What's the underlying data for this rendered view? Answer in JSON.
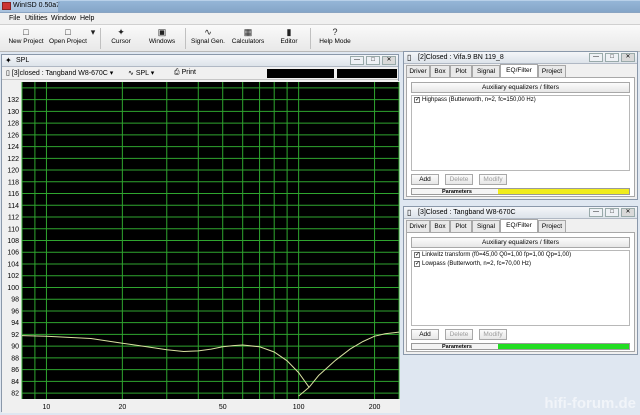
{
  "app": {
    "title": "WinISD 0.50a7"
  },
  "menu": [
    "File",
    "Utilities",
    "Window",
    "Help"
  ],
  "toolbar": {
    "new_project": "New Project",
    "open_project": "Open Project",
    "cursor": "Cursor",
    "windows": "Windows",
    "signal_gen": "Signal Gen.",
    "calculators": "Calculators",
    "editor": "Editor",
    "help_mode": "Help Mode",
    "help_icon": "?"
  },
  "spl_window": {
    "title": "SPL",
    "project_select": "[3]closed : Tangband W8-670C",
    "graph_select": "SPL",
    "print": "Print"
  },
  "panel_top": {
    "title": "[2]Closed : Vifa.9 BN 119_8",
    "tabs": [
      "Driver",
      "Box",
      "Plot",
      "Signal",
      "EQ/Filter",
      "Project"
    ],
    "active_tab": "EQ/Filter",
    "aux_button": "Auxiliary equalizers / filters",
    "filters": [
      "Highpass (Butterworth, n=2, fc=150,00 Hz)"
    ],
    "add": "Add",
    "delete": "Delete",
    "modify": "Modify",
    "parameters": "Parameters",
    "status_color": "#f0ec1c"
  },
  "panel_bottom": {
    "title": "[3]Closed : Tangband W8-670C",
    "tabs": [
      "Driver",
      "Box",
      "Plot",
      "Signal",
      "EQ/Filter",
      "Project"
    ],
    "active_tab": "EQ/Filter",
    "aux_button": "Auxiliary equalizers / filters",
    "filters": [
      "Linkwitz transform (f0=45,00 Q0=1,00 fp=1,00 Qp=1,00)",
      "Lowpass (Butterworth, n=2, fc=70,00 Hz)"
    ],
    "add": "Add",
    "delete": "Delete",
    "modify": "Modify",
    "parameters": "Parameters",
    "status_color": "#22dd22"
  },
  "watermark": "hifi-forum.de",
  "chart_data": {
    "type": "line",
    "x_scale": "log",
    "xlim": [
      8,
      250
    ],
    "ylim": [
      81,
      135
    ],
    "grid": true,
    "background": "#000000",
    "grid_color": "#2fa52f",
    "line_color": "#d8e0a0",
    "x_tick_labels": [
      10,
      20,
      50,
      100,
      200
    ],
    "y_tick_labels": [
      82,
      84,
      86,
      88,
      90,
      92,
      94,
      96,
      98,
      100,
      102,
      104,
      106,
      108,
      110,
      112,
      114,
      116,
      118,
      120,
      122,
      124,
      126,
      128,
      130,
      132
    ],
    "series": [
      {
        "x": [
          8,
          10,
          15,
          20,
          25,
          30,
          35,
          40,
          45,
          50,
          55,
          60,
          70,
          80,
          90,
          100,
          110
        ],
        "y": [
          91.8,
          91.7,
          91.3,
          90.5,
          89.9,
          89.4,
          89.1,
          89.2,
          89.5,
          89.9,
          90.1,
          90.2,
          89.9,
          89.0,
          87.5,
          85.5,
          83.0
        ]
      },
      {
        "x": [
          100,
          110,
          120,
          140,
          160,
          180,
          200,
          220,
          250
        ],
        "y": [
          81.5,
          83.0,
          85.0,
          87.6,
          89.5,
          90.8,
          91.7,
          92.1,
          92.4
        ]
      }
    ]
  }
}
